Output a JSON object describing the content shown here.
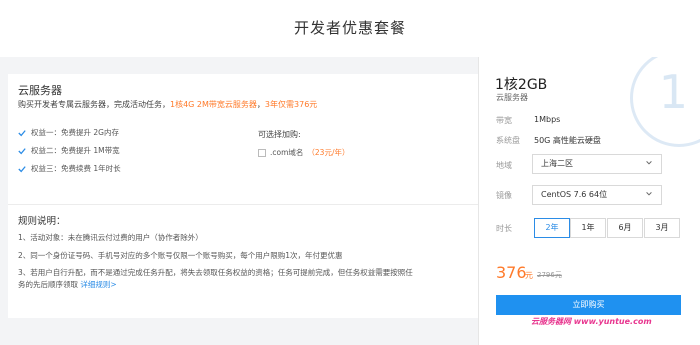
{
  "page": {
    "title": "开发者优惠套餐"
  },
  "offer": {
    "title": "云服务器",
    "desc_a": "购买开发者专属云服务器，完成活动任务，",
    "desc_hl1": "1核4G 2M带宽云服务器",
    "desc_b": "，",
    "desc_hl2": "3年仅需376元",
    "benefits": [
      "权益一：免费提升 2G内存",
      "权益二：免费提升 1M带宽",
      "权益三：免费续费 1年时长"
    ],
    "addon_title": "可选择加购:",
    "addon_label": ".com域名",
    "addon_price": "（23元/年）"
  },
  "rules": {
    "title": "规则说明：",
    "items": [
      "1、活动对象：未在腾讯云付过费的用户（协作者除外）",
      "2、同一个身份证号码、手机号对应的多个账号仅限一个账号购买，每个用户限购1次，年付更优惠",
      "3、若用户自行升配，而不是通过完成任务升配，将失去领取任务权益的资格；任务可提前完成，但任务权益需要按照任",
      "务的先后顺序领取"
    ],
    "detail_link": "详细规则>"
  },
  "product": {
    "badge_number": "1",
    "title": "1核2GB",
    "subtitle": "云服务器",
    "bandwidth_label": "带宽",
    "bandwidth_value": "1Mbps",
    "disk_label": "系统盘",
    "disk_value": "50G 高性能云硬盘",
    "region_label": "地域",
    "region_value": "上海二区",
    "image_label": "镜像",
    "image_value": "CentOS 7.6 64位",
    "duration_label": "时长",
    "durations": [
      "2年",
      "1年",
      "6月",
      "3月"
    ],
    "price": "376",
    "price_unit": "元",
    "original_price": "2796元",
    "buy_label": "立即购买"
  },
  "watermark": {
    "cn": "云服务器网",
    "url": " www.yuntue.com"
  },
  "colors": {
    "accent": "#1f91f0",
    "highlight": "#ff7a2a",
    "check": "#2b8ce6"
  },
  "icons": {
    "check": "check-icon",
    "chevron": "chevron-down-icon",
    "checkbox": "checkbox-icon"
  }
}
